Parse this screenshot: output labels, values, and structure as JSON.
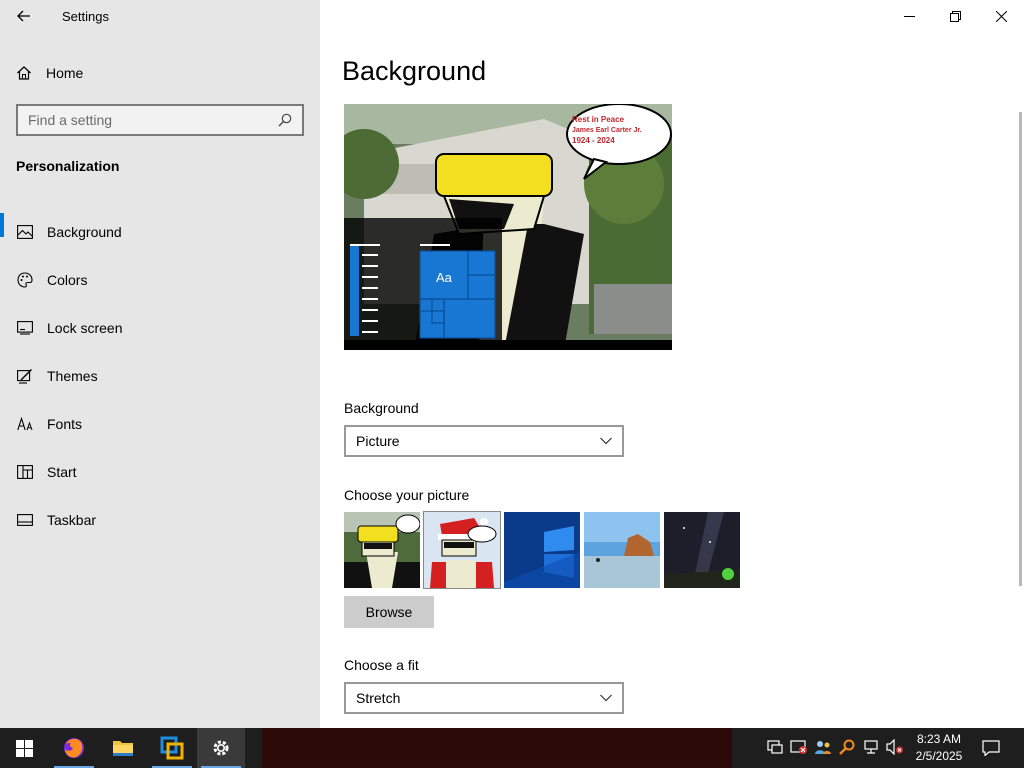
{
  "window": {
    "title": "Settings",
    "controls": [
      "minimize",
      "restore",
      "close"
    ]
  },
  "sidebar": {
    "home_label": "Home",
    "search_placeholder": "Find a setting",
    "section_title": "Personalization",
    "items": [
      {
        "label": "Background",
        "icon": "picture-icon",
        "active": true
      },
      {
        "label": "Colors",
        "icon": "palette-icon",
        "active": false
      },
      {
        "label": "Lock screen",
        "icon": "lock-screen-icon",
        "active": false
      },
      {
        "label": "Themes",
        "icon": "themes-icon",
        "active": false
      },
      {
        "label": "Fonts",
        "icon": "fonts-icon",
        "active": false
      },
      {
        "label": "Start",
        "icon": "start-icon",
        "active": false
      },
      {
        "label": "Taskbar",
        "icon": "taskbar-icon",
        "active": false
      }
    ]
  },
  "main": {
    "title": "Background",
    "preview": {
      "tile_text": "Aa",
      "speech_lines": [
        "Rest in Peace",
        "James Earl Carter Jr.",
        "1924 - 2024"
      ]
    },
    "background_label": "Background",
    "background_value": "Picture",
    "choose_picture_label": "Choose your picture",
    "browse_label": "Browse",
    "fit_label": "Choose a fit",
    "fit_value": "Stretch"
  },
  "taskbar": {
    "apps": [
      "start-icon",
      "firefox-icon",
      "file-explorer-icon",
      "virtualbox-icon",
      "settings-icon"
    ],
    "tray_icons": [
      "desktop-icon",
      "security-icon",
      "network-people-icon",
      "search-tool-icon",
      "network-icon",
      "volume-muted-icon"
    ],
    "time": "8:23 AM",
    "date": "2/5/2025"
  },
  "colors": {
    "accent": "#0078d7",
    "sidebar_bg": "#e6e6e6",
    "taskbar_bg": "#1e1e1e"
  }
}
